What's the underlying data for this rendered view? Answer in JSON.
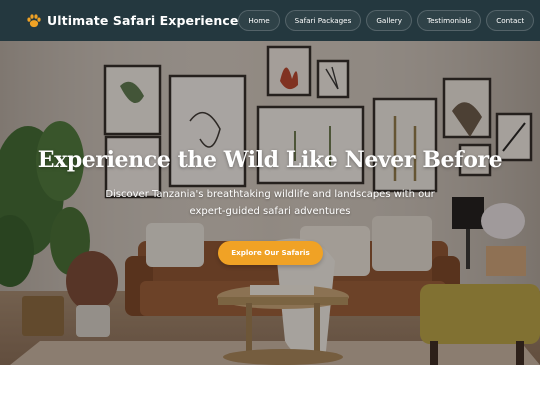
{
  "header": {
    "brand_title": "Ultimate Safari Experience",
    "brand_icon": "paw-icon"
  },
  "nav": {
    "items": [
      {
        "label": "Home"
      },
      {
        "label": "Safari Packages"
      },
      {
        "label": "Gallery"
      },
      {
        "label": "Testimonials"
      },
      {
        "label": "Contact"
      }
    ]
  },
  "hero": {
    "title": "Experience the Wild Like Never Before",
    "subtitle": "Discover Tanzania's breathtaking wildlife and landscapes with our expert-guided safari adventures",
    "cta_label": "Explore Our Safaris"
  },
  "colors": {
    "header_bg": "#24383f",
    "accent": "#f0a225",
    "text_on_dark": "#ffffff"
  }
}
